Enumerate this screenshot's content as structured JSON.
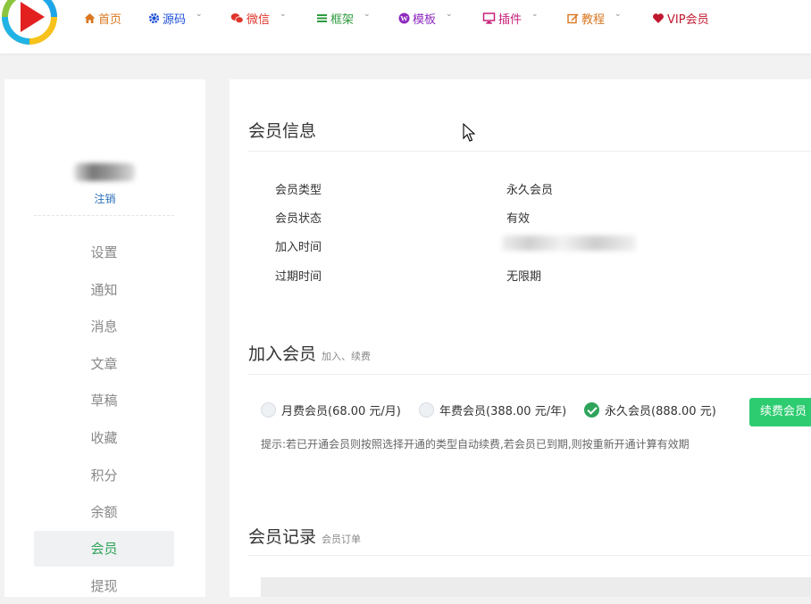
{
  "nav": {
    "items": [
      {
        "label": "首页",
        "icon": "home-icon",
        "color": "#d9761f",
        "caret": false
      },
      {
        "label": "源码",
        "icon": "gear-icon",
        "color": "#1e4fd8",
        "caret": true
      },
      {
        "label": "微信",
        "icon": "wechat-icon",
        "color": "#e0352b",
        "caret": true
      },
      {
        "label": "框架",
        "icon": "bars-icon",
        "color": "#2e9b3e",
        "caret": true
      },
      {
        "label": "模板",
        "icon": "wordpress-icon",
        "color": "#8e2bbf",
        "caret": true
      },
      {
        "label": "插件",
        "icon": "desktop-icon",
        "color": "#c8207a",
        "caret": true
      },
      {
        "label": "教程",
        "icon": "edit-icon",
        "color": "#d9761f",
        "caret": true
      },
      {
        "label": "VIP会员",
        "icon": "heart-icon",
        "color": "#c0182f",
        "caret": false
      }
    ]
  },
  "sidebar": {
    "logout_label": "注销",
    "items": [
      {
        "label": "设置"
      },
      {
        "label": "通知"
      },
      {
        "label": "消息"
      },
      {
        "label": "文章"
      },
      {
        "label": "草稿"
      },
      {
        "label": "收藏"
      },
      {
        "label": "积分"
      },
      {
        "label": "余额"
      },
      {
        "label": "会员",
        "active": true
      },
      {
        "label": "提现"
      }
    ]
  },
  "member_info": {
    "title": "会员信息",
    "rows": [
      {
        "label": "会员类型",
        "value": "永久会员"
      },
      {
        "label": "会员状态",
        "value": "有效"
      },
      {
        "label": "加入时间",
        "value": ""
      },
      {
        "label": "过期时间",
        "value": "无限期"
      }
    ]
  },
  "join": {
    "title": "加入会员",
    "subtitle": "加入、续费",
    "options": [
      {
        "label": "月费会员(68.00 元/月)",
        "checked": false
      },
      {
        "label": "年费会员(388.00 元/年)",
        "checked": false
      },
      {
        "label": "永久会员(888.00 元)",
        "checked": true
      }
    ],
    "button_label": "续费会员",
    "tip": "提示:若已开通会员则按照选择开通的类型自动续费,若会员已到期,则按重新开通计算有效期"
  },
  "records": {
    "title": "会员记录",
    "subtitle": "会员订单"
  },
  "colors": {
    "accent": "#2ecc71",
    "active_menu": "#2ea45a",
    "link": "#2a6fb8"
  }
}
